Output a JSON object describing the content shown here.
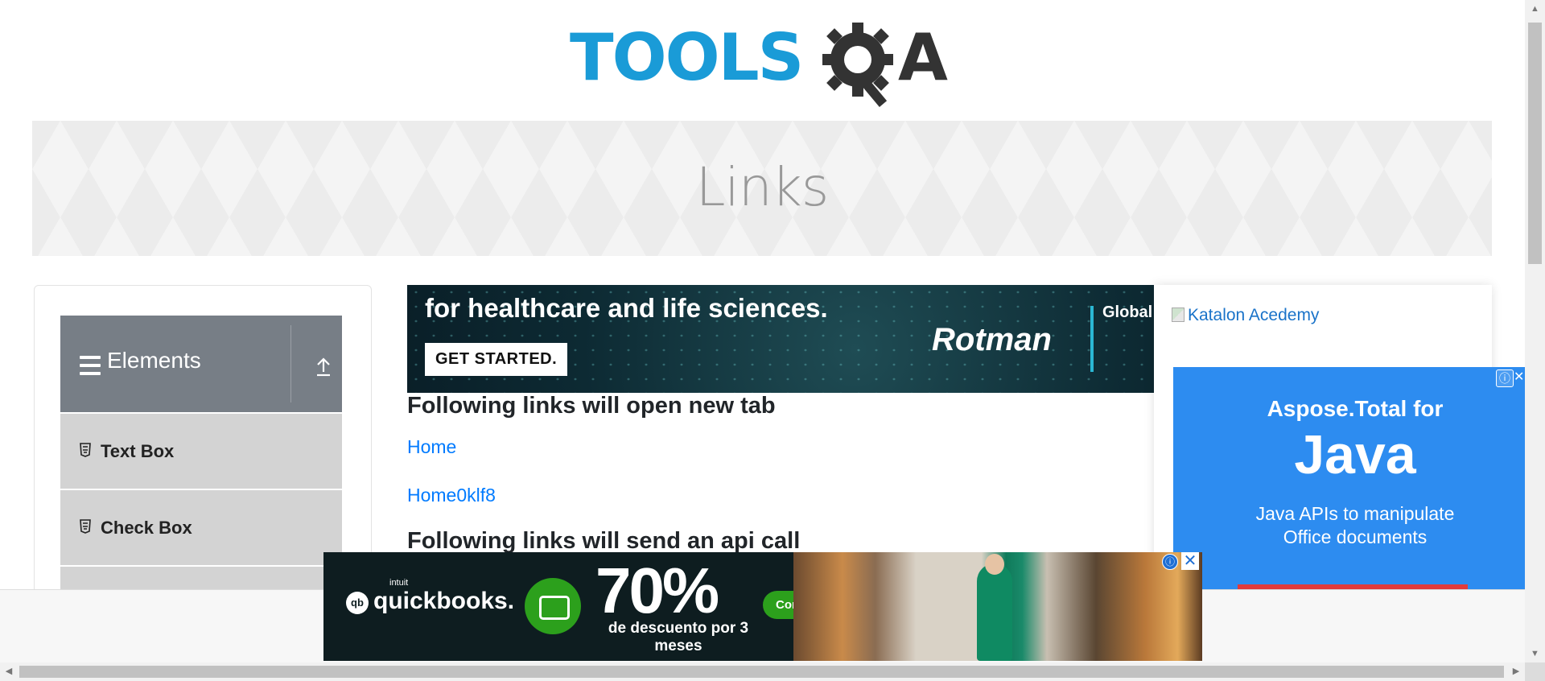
{
  "header": {
    "logo_text": "TOOLS",
    "logo_tail": "A"
  },
  "banner": {
    "title": "Links"
  },
  "sidebar": {
    "group_title": "Elements",
    "items": [
      {
        "label": "Text Box"
      },
      {
        "label": "Check Box"
      }
    ]
  },
  "ad_top": {
    "headline": "for healthcare and life sciences.",
    "cta": "GET STARTED.",
    "brand": "Rotman",
    "side_text": "Global Execu for He the Lif"
  },
  "main": {
    "heading_new_tab": "Following links will open new tab",
    "links_new_tab": [
      "Home",
      "Home0klf8"
    ],
    "heading_api": "Following links will send an api call"
  },
  "right": {
    "katalon_alt": "Katalon Acedemy",
    "aspose_line1": "Aspose.Total for",
    "aspose_line2": "Java",
    "aspose_line3": "Java APIs to manipulate",
    "aspose_line4": "Office documents"
  },
  "bottom_ad": {
    "intuit": "intuit",
    "brand": "quickbooks.",
    "qb_mark": "qb",
    "percent": "70%",
    "subtext": "de descuento por 3 meses",
    "button": "Compre ahora y ahorre"
  },
  "icons": {
    "info": "ⓘ",
    "close": "✕"
  },
  "colors": {
    "link": "#007bff",
    "logo_blue": "#1a9bd7",
    "menu_header": "#777e86",
    "menu_item": "#d3d3d3",
    "qb_green": "#2ca01c",
    "aspose_blue": "#2d8cf0"
  }
}
